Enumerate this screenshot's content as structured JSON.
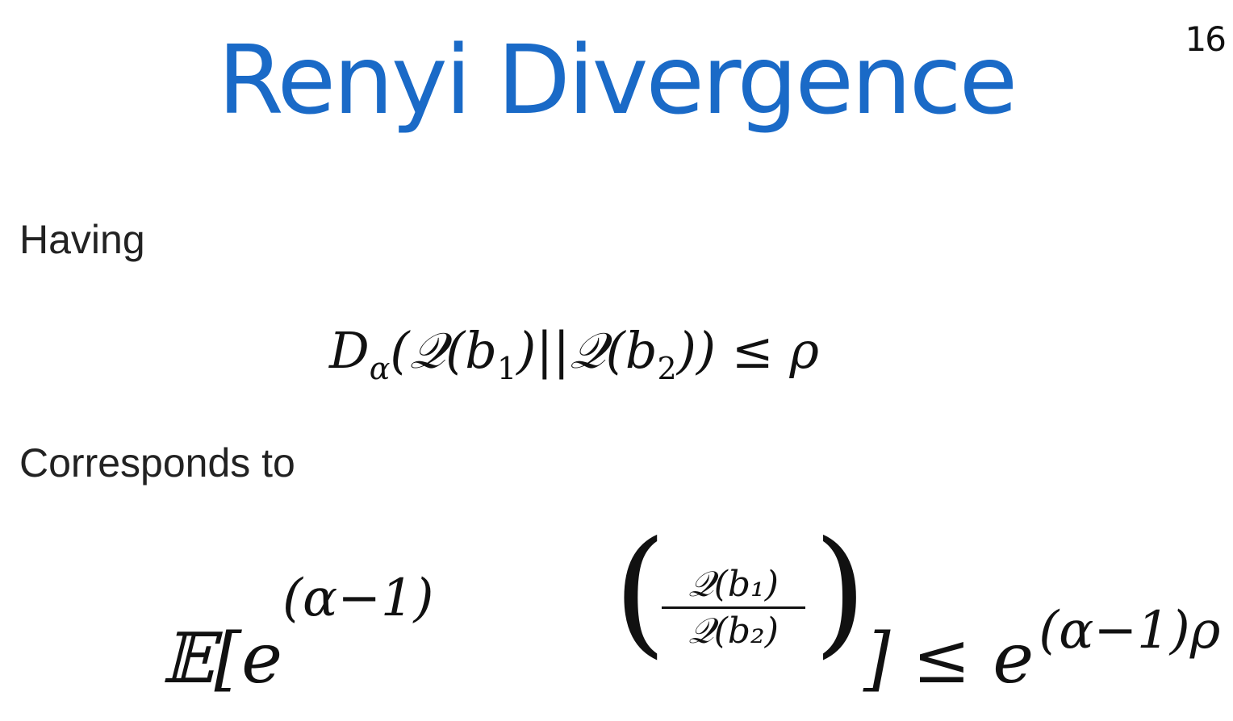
{
  "slide": {
    "page_number": "16",
    "title": "Renyi Divergence",
    "text_having": "Having",
    "text_corresponds": "Corresponds to"
  },
  "equation1": {
    "D": "D",
    "alpha_sub": "α",
    "rest": "(𝒬(b",
    "sub1": "1",
    "mid": ")||𝒬(b",
    "sub2": "2",
    "end": ")) ≤ ρ"
  },
  "equation2": {
    "E": "𝔼[e",
    "exp_left": "(α−1)",
    "frac_num": "𝒬(b₁)",
    "frac_den": "𝒬(b₂)",
    "close": "] ≤ e",
    "exp_right": "(α−1)ρ",
    "paren_open": "(",
    "paren_close": ")"
  }
}
